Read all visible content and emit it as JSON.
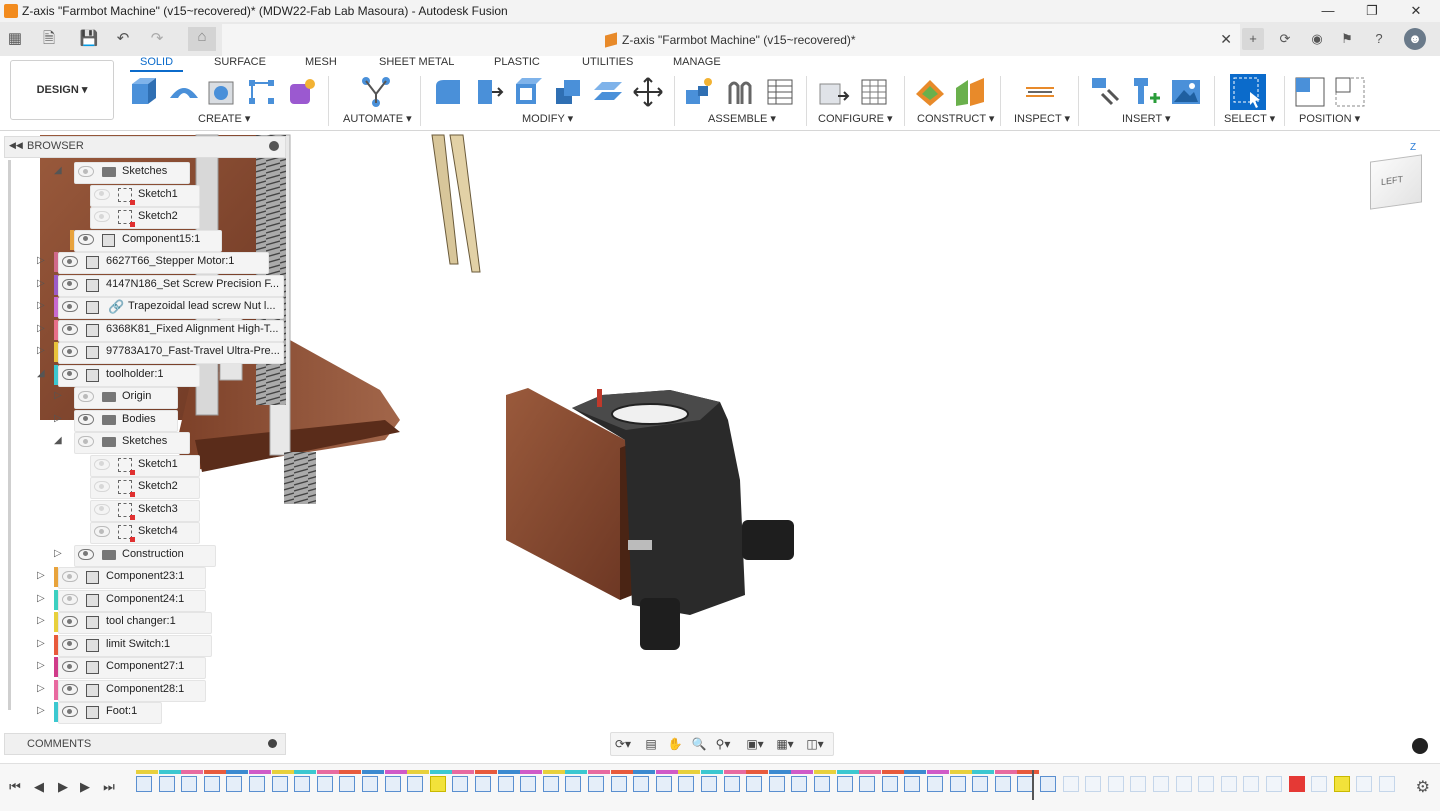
{
  "window": {
    "title": "Z-axis \"Farmbot Machine\" (v15~recovered)* (MDW22-Fab Lab Masoura) - Autodesk Fusion"
  },
  "tabbar": {
    "document_tab": "Z-axis \"Farmbot Machine\" (v15~recovered)*"
  },
  "ribbon": {
    "workspace": "DESIGN",
    "tabs": [
      "SOLID",
      "SURFACE",
      "MESH",
      "SHEET METAL",
      "PLASTIC",
      "UTILITIES",
      "MANAGE"
    ],
    "groups": [
      "CREATE",
      "AUTOMATE",
      "MODIFY",
      "ASSEMBLE",
      "CONFIGURE",
      "CONSTRUCT",
      "INSPECT",
      "INSERT",
      "SELECT",
      "POSITION"
    ],
    "accent": "#0b6bcb"
  },
  "browser": {
    "title": "BROWSER",
    "nodes": [
      {
        "label": "Sketches",
        "kind": "folder",
        "level": 2,
        "expand": "open",
        "bar": "",
        "eye": "off"
      },
      {
        "label": "Sketch1",
        "kind": "sketch",
        "level": 3,
        "expand": "",
        "bar": "",
        "eye": "faint"
      },
      {
        "label": "Sketch2",
        "kind": "sketch",
        "level": 3,
        "expand": "",
        "bar": "",
        "eye": "faint"
      },
      {
        "label": "Component15:1",
        "kind": "comp",
        "level": 2,
        "expand": "",
        "bar": "#e8a33c",
        "eye": "on"
      },
      {
        "label": "6627T66_Stepper Motor:1",
        "kind": "comp",
        "level": 1,
        "expand": "closed",
        "bar": "#d06a8a",
        "eye": "on"
      },
      {
        "label": "4147N186_Set Screw Precision F...",
        "kind": "comp",
        "level": 1,
        "expand": "closed",
        "bar": "#9c5cc8",
        "eye": "on"
      },
      {
        "label": "Trapezoidal lead screw Nut l...",
        "kind": "link",
        "level": 1,
        "expand": "closed",
        "bar": "#c86ad0",
        "eye": "on"
      },
      {
        "label": "6368K81_Fixed Alignment High-T...",
        "kind": "comp",
        "level": 1,
        "expand": "closed",
        "bar": "#e8708a",
        "eye": "on"
      },
      {
        "label": "97783A170_Fast-Travel Ultra-Pre...",
        "kind": "comp",
        "level": 1,
        "expand": "closed",
        "bar": "#e8c23c",
        "eye": "on"
      },
      {
        "label": "toolholder:1",
        "kind": "comp",
        "level": 1,
        "expand": "open",
        "bar": "#3cc8d0",
        "eye": "on"
      },
      {
        "label": "Origin",
        "kind": "folder",
        "level": 2,
        "expand": "closed",
        "bar": "",
        "eye": "off"
      },
      {
        "label": "Bodies",
        "kind": "folder",
        "level": 2,
        "expand": "closed",
        "bar": "",
        "eye": "on"
      },
      {
        "label": "Sketches",
        "kind": "folder",
        "level": 2,
        "expand": "open",
        "bar": "",
        "eye": "off"
      },
      {
        "label": "Sketch1",
        "kind": "sketch",
        "level": 3,
        "expand": "",
        "bar": "",
        "eye": "faint"
      },
      {
        "label": "Sketch2",
        "kind": "sketch",
        "level": 3,
        "expand": "",
        "bar": "",
        "eye": "faint"
      },
      {
        "label": "Sketch3",
        "kind": "sketch",
        "level": 3,
        "expand": "",
        "bar": "",
        "eye": "faint"
      },
      {
        "label": "Sketch4",
        "kind": "sketch",
        "level": 3,
        "expand": "",
        "bar": "",
        "eye": "off"
      },
      {
        "label": "Construction",
        "kind": "folder",
        "level": 2,
        "expand": "closed",
        "bar": "",
        "eye": "on"
      },
      {
        "label": "Component23:1",
        "kind": "comp",
        "level": 1,
        "expand": "closed",
        "bar": "#e8a33c",
        "eye": "off"
      },
      {
        "label": "Component24:1",
        "kind": "comp",
        "level": 1,
        "expand": "closed",
        "bar": "#3cd0c0",
        "eye": "off"
      },
      {
        "label": "tool changer:1",
        "kind": "comp",
        "level": 1,
        "expand": "closed",
        "bar": "#e8d03c",
        "eye": "on"
      },
      {
        "label": "limit Switch:1",
        "kind": "comp",
        "level": 1,
        "expand": "closed",
        "bar": "#e85a3c",
        "eye": "on"
      },
      {
        "label": "Component27:1",
        "kind": "comp",
        "level": 1,
        "expand": "closed",
        "bar": "#d03c8a",
        "eye": "on"
      },
      {
        "label": "Component28:1",
        "kind": "comp",
        "level": 1,
        "expand": "closed",
        "bar": "#e86aa0",
        "eye": "on"
      },
      {
        "label": "Foot:1",
        "kind": "comp",
        "level": 1,
        "expand": "closed",
        "bar": "#3cc8d0",
        "eye": "on"
      }
    ]
  },
  "comments": {
    "title": "COMMENTS"
  },
  "viewcube": {
    "face": "LEFT",
    "axis": "Z"
  }
}
